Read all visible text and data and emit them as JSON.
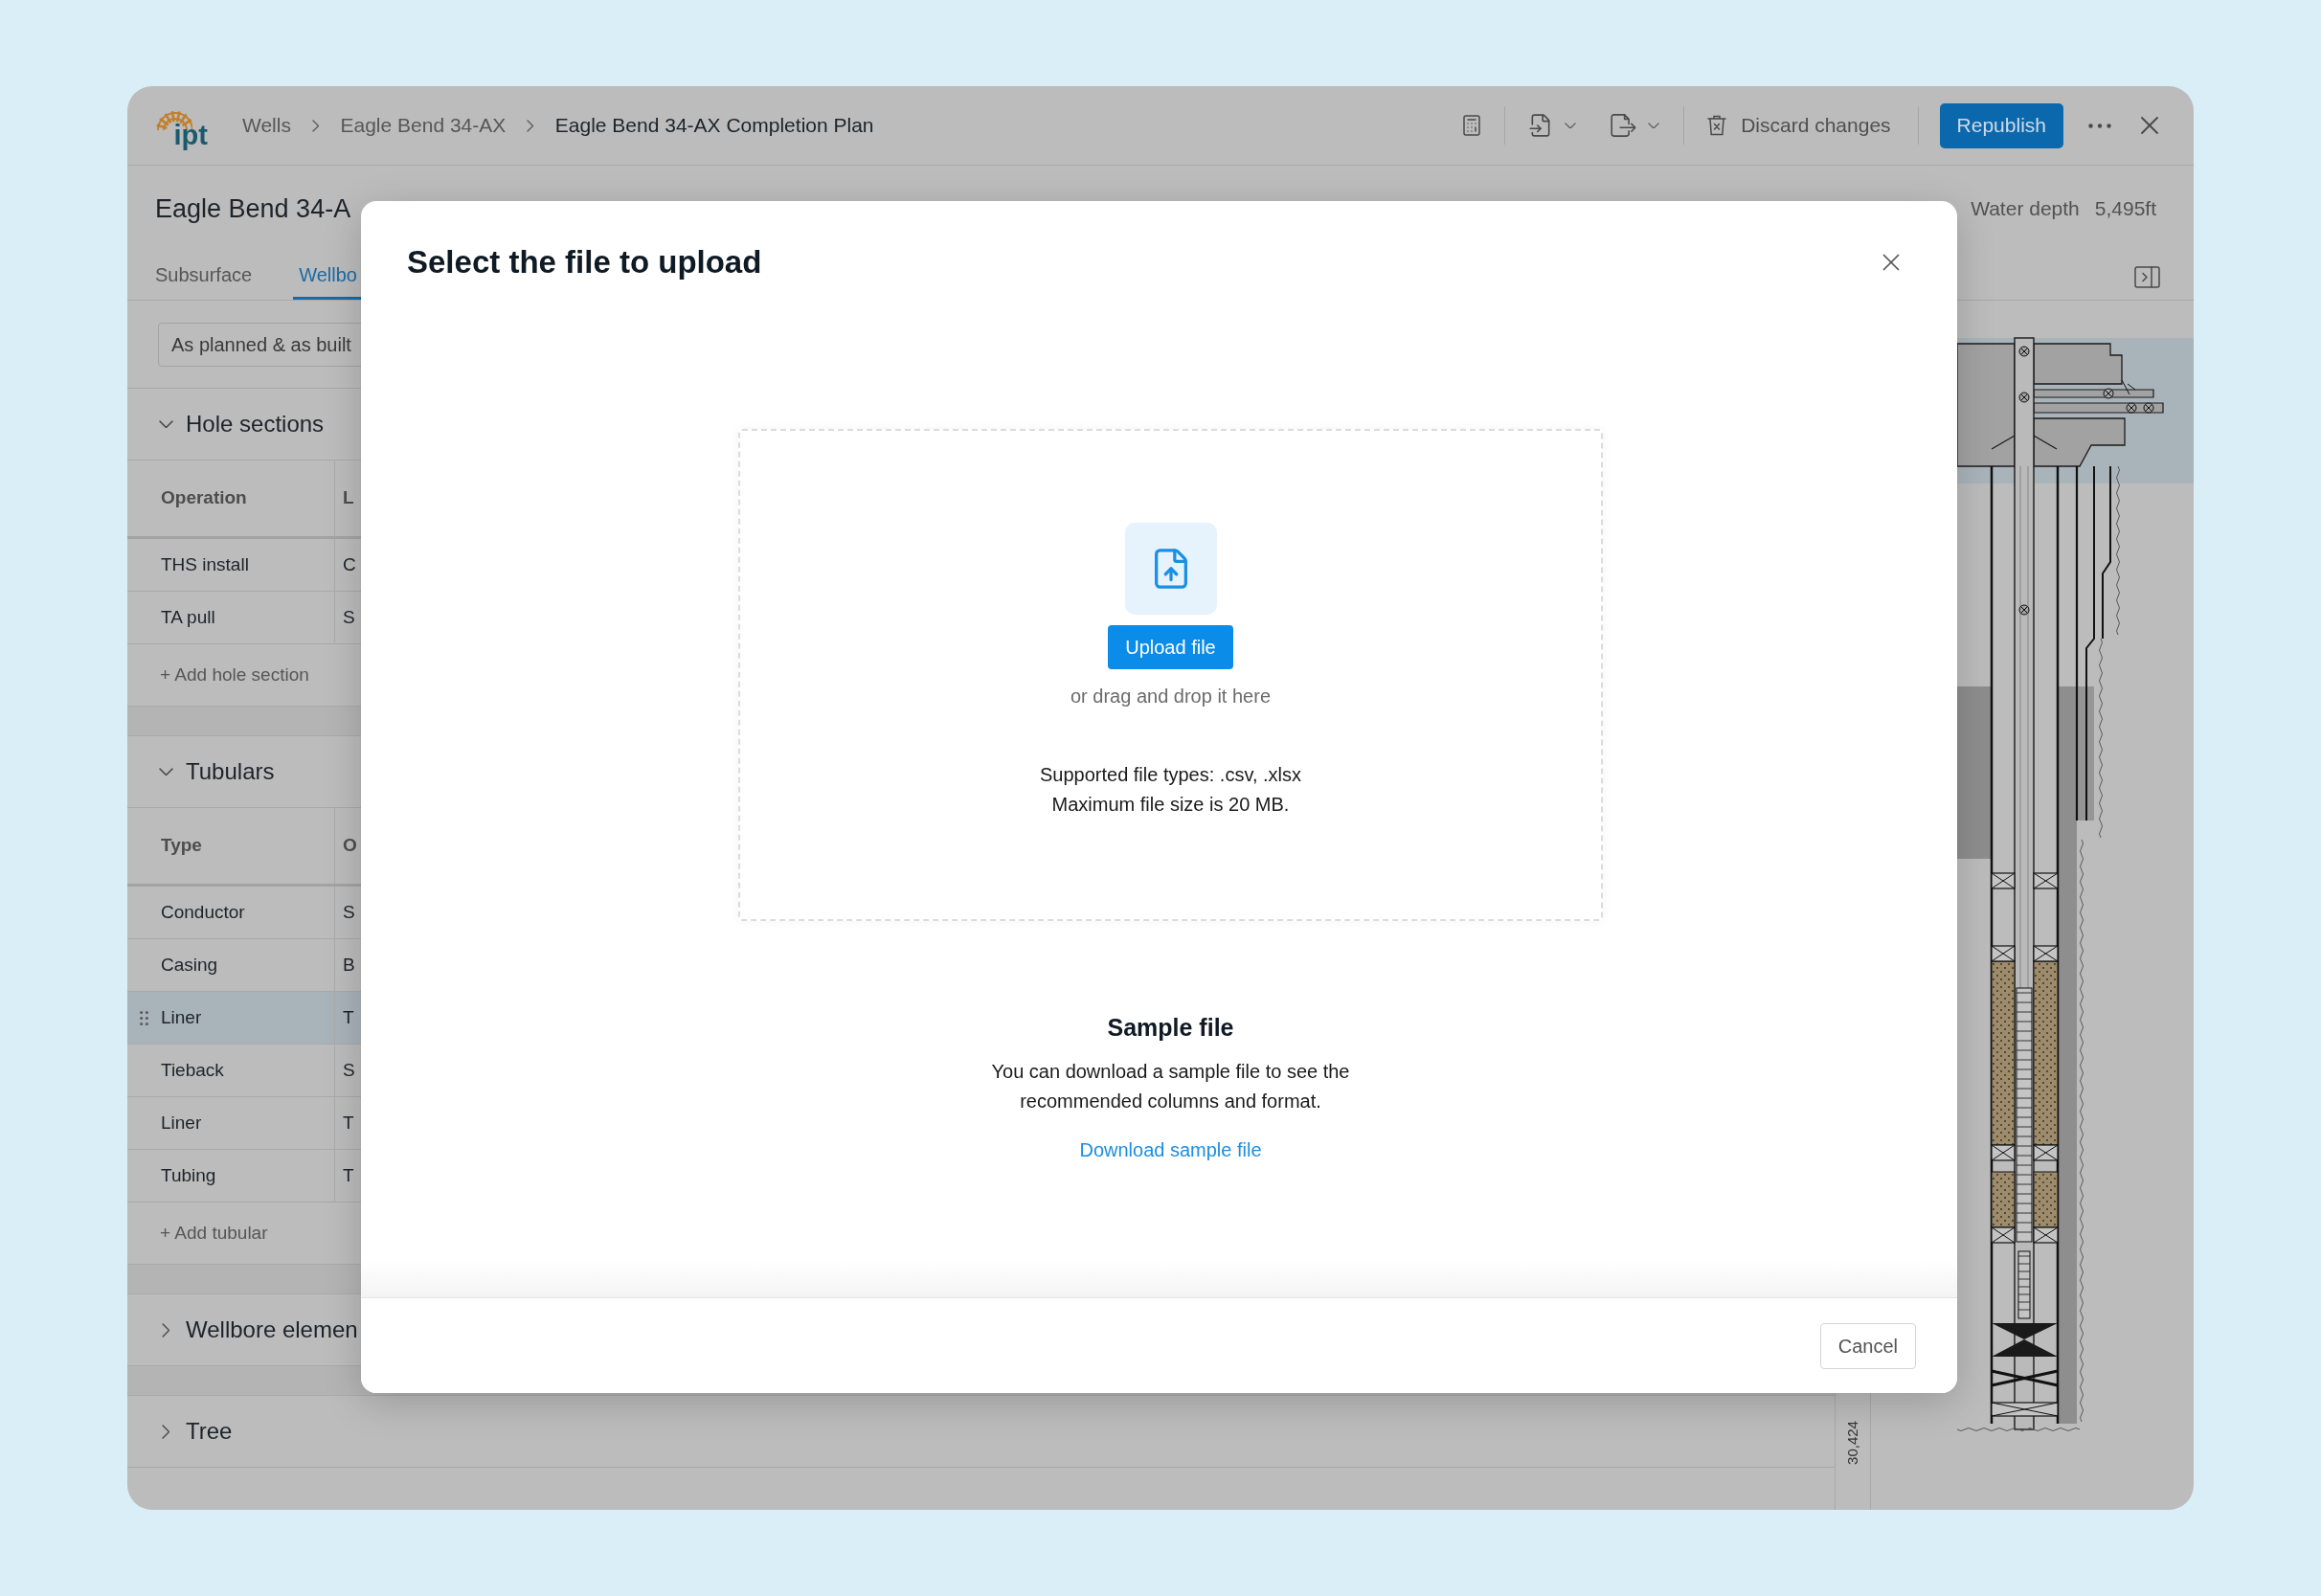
{
  "top_bar": {
    "logo_text": "ipt",
    "breadcrumbs": [
      {
        "label": "Wells",
        "current": false
      },
      {
        "label": "Eagle Bend 34-AX",
        "current": false
      },
      {
        "label": "Eagle Bend 34-AX Completion Plan",
        "current": true
      }
    ],
    "discard_button": "Discard changes",
    "publish_button": "Republish"
  },
  "header": {
    "title": "Eagle Bend 34-A",
    "water_depth_label": "Water depth",
    "water_depth_value": "5,495ft"
  },
  "tabs": [
    {
      "label": "Subsurface",
      "selected": false
    },
    {
      "label": "Wellbo",
      "selected": true
    }
  ],
  "view_select": {
    "value": "As planned & as built"
  },
  "sections": [
    {
      "title": "Hole sections",
      "expanded": true,
      "table": {
        "columns": [
          "Operation",
          "L"
        ],
        "rows": [
          {
            "cells": [
              "THS install",
              "C"
            ],
            "selected": false
          },
          {
            "cells": [
              "TA pull",
              "S"
            ],
            "selected": false
          }
        ]
      },
      "add_label": "+ Add hole section"
    },
    {
      "title": "Tubulars",
      "expanded": true,
      "table": {
        "columns": [
          "Type",
          "O"
        ],
        "rows": [
          {
            "cells": [
              "Conductor",
              "S"
            ],
            "selected": false
          },
          {
            "cells": [
              "Casing",
              "B"
            ],
            "selected": false
          },
          {
            "cells": [
              "Liner",
              "T"
            ],
            "selected": true
          },
          {
            "cells": [
              "Tieback",
              "S"
            ],
            "selected": false
          },
          {
            "cells": [
              "Liner",
              "T"
            ],
            "selected": false
          },
          {
            "cells": [
              "Tubing",
              "T"
            ],
            "selected": false
          }
        ]
      },
      "add_label": "+ Add tubular"
    },
    {
      "title": "Wellbore elemen",
      "expanded": false
    },
    {
      "title": "Tree",
      "expanded": false
    }
  ],
  "depth_ruler": {
    "label": "30,424"
  },
  "dialog": {
    "title": "Select the file to upload",
    "upload_button": "Upload file",
    "drop_hint": "or drag and drop it here",
    "file_info": [
      "Supported file types: .csv, .xlsx",
      "Maximum file size is 20 MB."
    ],
    "sample": {
      "title": "Sample file",
      "text": "You can download a sample file to see the recommended columns and format.",
      "link": "Download sample file"
    },
    "cancel_button": "Cancel"
  }
}
